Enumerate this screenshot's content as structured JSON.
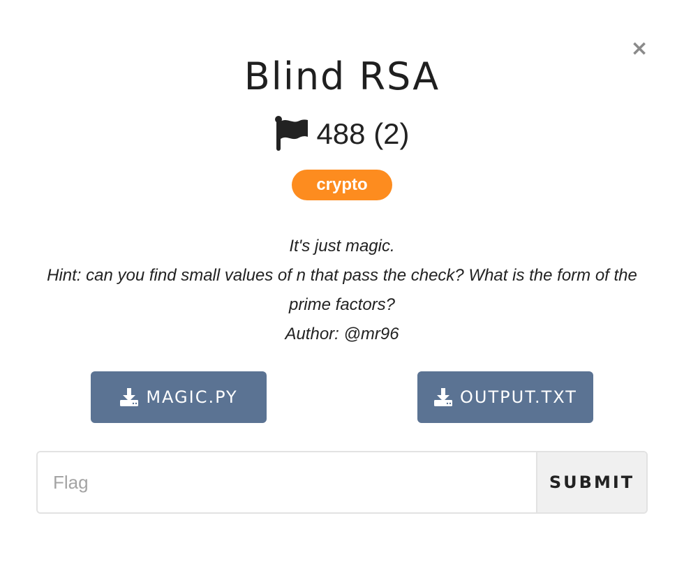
{
  "modal": {
    "close_symbol": "×",
    "title": "Blind RSA",
    "score": "488 (2)",
    "category": "crypto",
    "colors": {
      "badge": "#fd8c1f",
      "download_button": "#5b7393",
      "submit_background": "#f0f0f0"
    },
    "description": {
      "line1": "It's just magic.",
      "line2": "Hint: can you find small values of n that pass the check? What is the form of the prime factors?",
      "line3": "Author: @mr96"
    },
    "files": [
      {
        "label": "MAGIC.PY",
        "icon": "download-icon"
      },
      {
        "label": "OUTPUT.TXT",
        "icon": "download-icon"
      }
    ],
    "form": {
      "placeholder": "Flag",
      "value": "",
      "submit_label": "SUBMIT"
    }
  }
}
